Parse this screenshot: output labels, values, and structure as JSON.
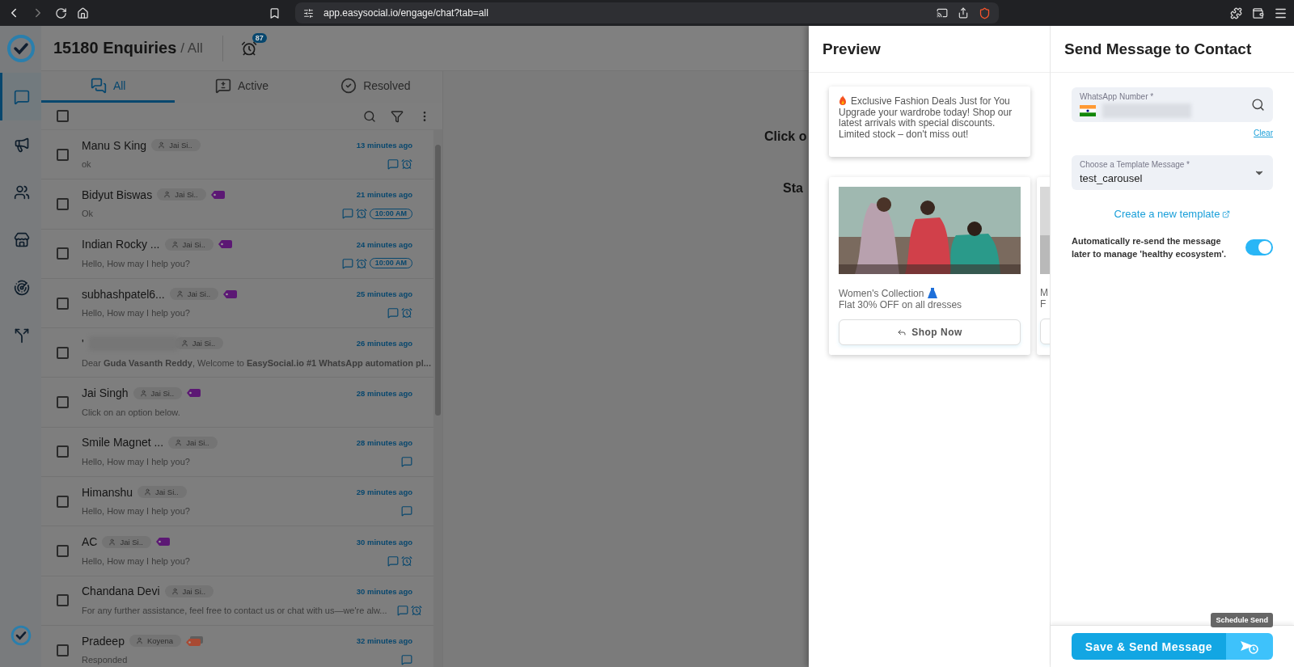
{
  "browser": {
    "url": "app.easysocial.io/engage/chat?tab=all"
  },
  "sidebar": {
    "items": [
      {
        "selected": true
      },
      {
        "selected": false
      },
      {
        "selected": false
      },
      {
        "selected": false
      },
      {
        "selected": false
      },
      {
        "selected": false
      }
    ]
  },
  "header": {
    "count_title": "15180 Enquiries",
    "filter": "/ All",
    "reminder_badge": "87"
  },
  "tabs": [
    {
      "label": "All",
      "selected": true
    },
    {
      "label": "Active",
      "selected": false
    },
    {
      "label": "Resolved",
      "selected": false
    }
  ],
  "select_all": {
    "checked": false
  },
  "conversations": [
    {
      "name": "Manu S King",
      "checked": false,
      "agent": "Jai Si..",
      "time": "13 minutes ago",
      "preview": "ok",
      "message_icon": true,
      "reminder": true
    },
    {
      "name": "Bidyut Biswas",
      "checked": false,
      "agent": "Jai Si..",
      "tag": {
        "color": "#5c1874",
        "stacked": false
      },
      "time": "21 minutes ago",
      "preview": "Ok",
      "message_icon": true,
      "reminder": true,
      "scheduled": "10:00 AM"
    },
    {
      "name": "Indian Rocky ...",
      "checked": false,
      "agent": "Jai Si..",
      "tag": {
        "color": "#5c1874",
        "stacked": false
      },
      "time": "24 minutes ago",
      "preview": "Hello, How may I help you?",
      "message_icon": true,
      "reminder": true,
      "scheduled": "10:00 AM"
    },
    {
      "name": "subhashpatel6...",
      "checked": false,
      "agent": "Jai Si..",
      "tag": {
        "color": "#5c1874",
        "stacked": false
      },
      "time": "25 minutes ago",
      "preview": "Hello, How may I help you?",
      "message_icon": true,
      "reminder": true
    },
    {
      "name": "'",
      "redacted": true,
      "checked": false,
      "agent": "Jai Si..",
      "time": "26 minutes ago",
      "preview": "Dear **Guda Vasanth Reddy**, Welcome to **EasySocial.io #1 WhatsApp automation pl...**",
      "message_icon": false,
      "reminder": false
    },
    {
      "name": "Jai Singh",
      "checked": false,
      "agent": "Jai Si..",
      "tag": {
        "color": "#5c1874",
        "stacked": false
      },
      "time": "28 minutes ago",
      "preview": "Click on an option below.",
      "message_icon": false,
      "reminder": false
    },
    {
      "name": "Smile Magnet ...",
      "checked": false,
      "agent": "Jai Si..",
      "time": "28 minutes ago",
      "preview": "Hello, How may I help you?",
      "message_icon": true,
      "reminder": false
    },
    {
      "name": "Himanshu",
      "checked": false,
      "agent": "Jai Si..",
      "time": "29 minutes ago",
      "preview": "Hello, How may I help you?",
      "message_icon": true,
      "reminder": false
    },
    {
      "name": "AC",
      "checked": false,
      "agent": "Jai Si..",
      "tag": {
        "color": "#5c1874",
        "stacked": false
      },
      "time": "30 minutes ago",
      "preview": "Hello, How may I help you?",
      "message_icon": true,
      "reminder": true
    },
    {
      "name": "Chandana Devi",
      "checked": false,
      "agent": "Jai Si..",
      "time": "30 minutes ago",
      "preview": "For any further assistance, feel free to contact us or chat with us—we're alw...",
      "message_icon": true,
      "reminder": true
    },
    {
      "name": "Pradeep",
      "checked": false,
      "agent": "Koyena",
      "tag": {
        "color": "#a94a33",
        "stacked": true
      },
      "time": "32 minutes ago",
      "preview": "Responded",
      "message_icon": true,
      "reminder": false
    }
  ],
  "chat_area": {
    "hint_lines": [
      "Click o",
      "Sta"
    ]
  },
  "preview": {
    "title": "Preview",
    "message": {
      "heading": "Exclusive Fashion Deals Just for You",
      "body": "Upgrade your wardrobe today! Shop our latest arrivals with special discounts. Limited stock – don't miss out!"
    },
    "cards": [
      {
        "kind": "picture",
        "title": "Women's Collection",
        "subtitle": "Flat 30% OFF on all dresses",
        "button": "Shop Now"
      },
      {
        "kind": "picture",
        "title": "M",
        "subtitle": "F"
      }
    ]
  },
  "send_panel": {
    "title": "Send Message to Contact",
    "number_field": {
      "label": "WhatsApp Number *"
    },
    "clear_link": "Clear",
    "template_field": {
      "label": "Choose a Template Message *",
      "value": "test_carousel"
    },
    "create_link": "Create a new template",
    "auto_resend": {
      "label": "Automatically re-send the message later to manage 'healthy ecosystem'.",
      "on": true
    },
    "send_button": "Save & Send Message",
    "schedule_tooltip": "Schedule Send"
  }
}
